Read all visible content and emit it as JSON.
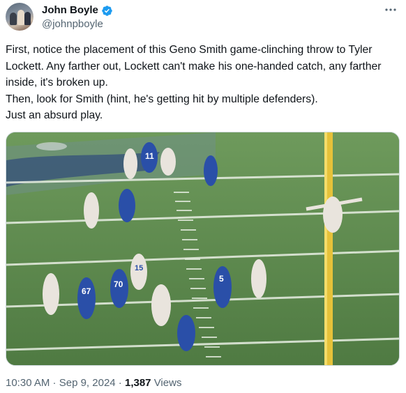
{
  "author": {
    "name": "John Boyle",
    "handle": "@johnpboyle"
  },
  "tweet": {
    "text": "First, notice the placement of this Geno Smith game-clinching throw to Tyler Lockett. Any farther out, Lockett can't make his one-handed catch, any farther inside, it's broken up.\nThen, look for Smith (hint, he's getting hit by multiple defenders).\nJust an absurd play."
  },
  "media": {
    "jersey_numbers": [
      "11",
      "70",
      "67",
      "15",
      "5"
    ]
  },
  "meta": {
    "time": "10:30 AM",
    "separator": " · ",
    "date": "Sep 9, 2024",
    "views_count": "1,387",
    "views_label": " Views"
  },
  "colors": {
    "verified": "#1d9bf0",
    "secondary_text": "#536471",
    "field_green": "#5d8a4e",
    "goalpost_yellow": "#e6c23a",
    "seahawks_blue": "#2a4fa8"
  },
  "icons": {
    "verified": "verified-badge-icon",
    "more": "more-dots-icon"
  }
}
